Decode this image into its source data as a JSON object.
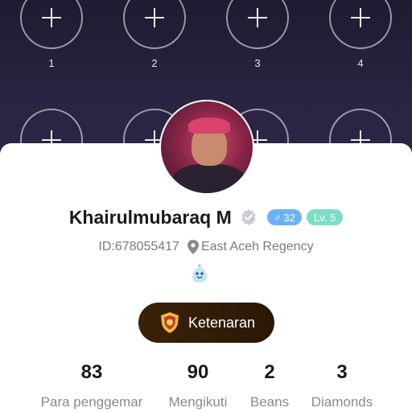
{
  "slots": [
    {
      "label": "1"
    },
    {
      "label": "2"
    },
    {
      "label": "3"
    },
    {
      "label": "4"
    },
    {
      "label": ""
    },
    {
      "label": ""
    },
    {
      "label": ""
    },
    {
      "label": ""
    }
  ],
  "profile": {
    "name": "Khairulmubaraq M",
    "gender_symbol": "♂",
    "age": "32",
    "level": "Lv. 5",
    "id_text": "ID:678055417",
    "location": "East Aceh Regency"
  },
  "fame_button": {
    "label": "Ketenaran"
  },
  "stats": [
    {
      "value": "83",
      "label": "Para penggemar"
    },
    {
      "value": "90",
      "label": "Mengikuti"
    },
    {
      "value": "2",
      "label": "Beans"
    },
    {
      "value": "3",
      "label": "Diamonds"
    }
  ],
  "colors": {
    "gender_badge": "#6ab3f3",
    "level_badge": "#7ddcc6",
    "fame_button": "#3a2208"
  }
}
